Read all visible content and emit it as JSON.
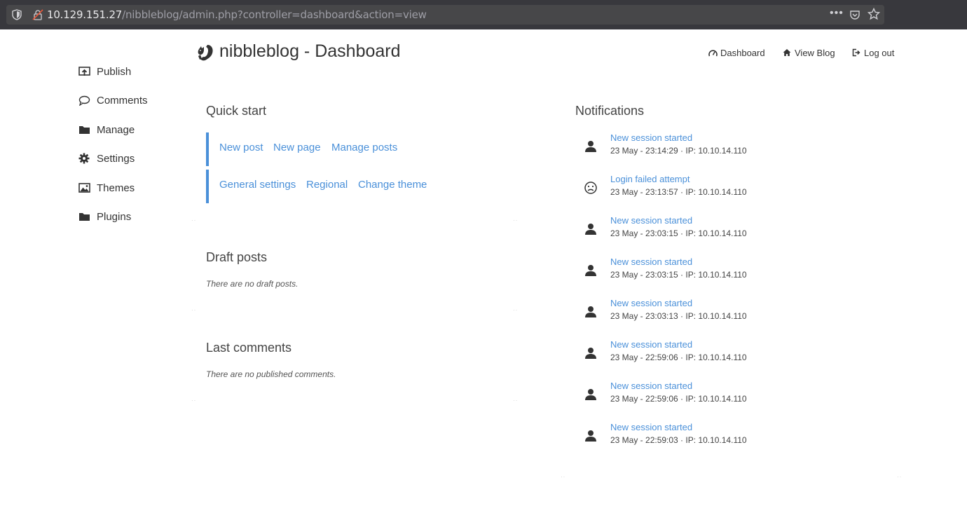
{
  "browser": {
    "url_host": "10.129.151.27",
    "url_path": "/nibbleblog/admin.php?controller=dashboard&action=view",
    "overflow_menu": "•••"
  },
  "sidebar": {
    "items": [
      {
        "label": "Publish",
        "icon": "publish-icon"
      },
      {
        "label": "Comments",
        "icon": "comment-icon"
      },
      {
        "label": "Manage",
        "icon": "folder-icon"
      },
      {
        "label": "Settings",
        "icon": "gear-icon"
      },
      {
        "label": "Themes",
        "icon": "image-icon"
      },
      {
        "label": "Plugins",
        "icon": "folder-icon"
      }
    ]
  },
  "header": {
    "brand": "nibbleblog - Dashboard",
    "nav": [
      {
        "label": "Dashboard",
        "icon": "dashboard-icon"
      },
      {
        "label": "View Blog",
        "icon": "home-icon"
      },
      {
        "label": "Log out",
        "icon": "logout-icon"
      }
    ]
  },
  "quick_start": {
    "title": "Quick start",
    "row1": [
      "New post",
      "New page",
      "Manage posts"
    ],
    "row2": [
      "General settings",
      "Regional",
      "Change theme"
    ]
  },
  "draft_posts": {
    "title": "Draft posts",
    "message": "There are no draft posts."
  },
  "last_comments": {
    "title": "Last comments",
    "message": "There are no published comments."
  },
  "notifications": {
    "title": "Notifications",
    "items": [
      {
        "title": "New session started",
        "meta": "23 May - 23:14:29 · IP: 10.10.14.110",
        "icon": "user-icon"
      },
      {
        "title": "Login failed attempt",
        "meta": "23 May - 23:13:57 · IP: 10.10.14.110",
        "icon": "frown-icon"
      },
      {
        "title": "New session started",
        "meta": "23 May - 23:03:15 · IP: 10.10.14.110",
        "icon": "user-icon"
      },
      {
        "title": "New session started",
        "meta": "23 May - 23:03:15 · IP: 10.10.14.110",
        "icon": "user-icon"
      },
      {
        "title": "New session started",
        "meta": "23 May - 23:03:13 · IP: 10.10.14.110",
        "icon": "user-icon"
      },
      {
        "title": "New session started",
        "meta": "23 May - 22:59:06 · IP: 10.10.14.110",
        "icon": "user-icon"
      },
      {
        "title": "New session started",
        "meta": "23 May - 22:59:06 · IP: 10.10.14.110",
        "icon": "user-icon"
      },
      {
        "title": "New session started",
        "meta": "23 May - 22:59:03 · IP: 10.10.14.110",
        "icon": "user-icon"
      }
    ]
  },
  "colors": {
    "link": "#4a90d9",
    "accent_bar": "#4a90d9",
    "text": "#333333",
    "chrome_bg": "#38383d"
  }
}
